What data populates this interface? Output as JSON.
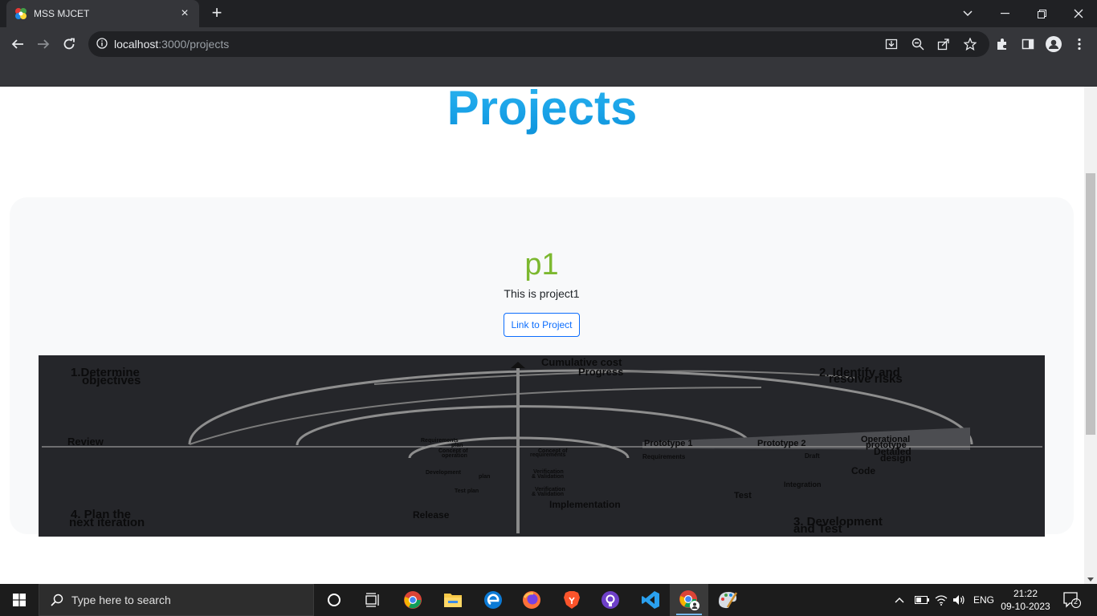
{
  "browser": {
    "tab_title": "MSS MJCET",
    "url_host": "localhost",
    "url_path": ":3000/projects"
  },
  "page": {
    "title": "Projects",
    "projects": [
      {
        "name": "p1",
        "description": "This is project1",
        "link_label": "Link to Project",
        "image": {
          "labels": {
            "q1": [
              "1.Determine",
              "objectives"
            ],
            "q2": [
              "2. Identify and",
              "resolve risks"
            ],
            "q3": [
              "3. Development",
              "and Test"
            ],
            "q4": [
              "4. Plan the",
              "next iteration"
            ],
            "cum1": "Cumulative cost",
            "cum2": "Progress",
            "review": "Review",
            "release": "Release",
            "impl": "Implementation",
            "test": "Test",
            "code": "Code",
            "integ": "Integration",
            "detailed": [
              "Detailed",
              "design"
            ],
            "draft": "Draft",
            "proto1": "Prototype 1",
            "proto2": "Prototype 2",
            "oper": [
              "Operational",
              "prototype"
            ],
            "req_plan": [
              "Requirements",
              "plan"
            ],
            "concept_op": [
              "Concept of",
              "operation"
            ],
            "concept_req": [
              "Concept of",
              "requirements"
            ],
            "reqs": "Requirements",
            "dev_plan": [
              "Development",
              "plan"
            ],
            "vv": [
              "Verification",
              "& Validation"
            ],
            "test_plan": "Test plan",
            "vv2": [
              "Verification",
              "& Validation"
            ]
          }
        }
      }
    ]
  },
  "taskbar": {
    "search_placeholder": "Type here to search",
    "language": "ENG",
    "time": "21:22",
    "date": "09-10-2023",
    "notification_count": "2"
  }
}
